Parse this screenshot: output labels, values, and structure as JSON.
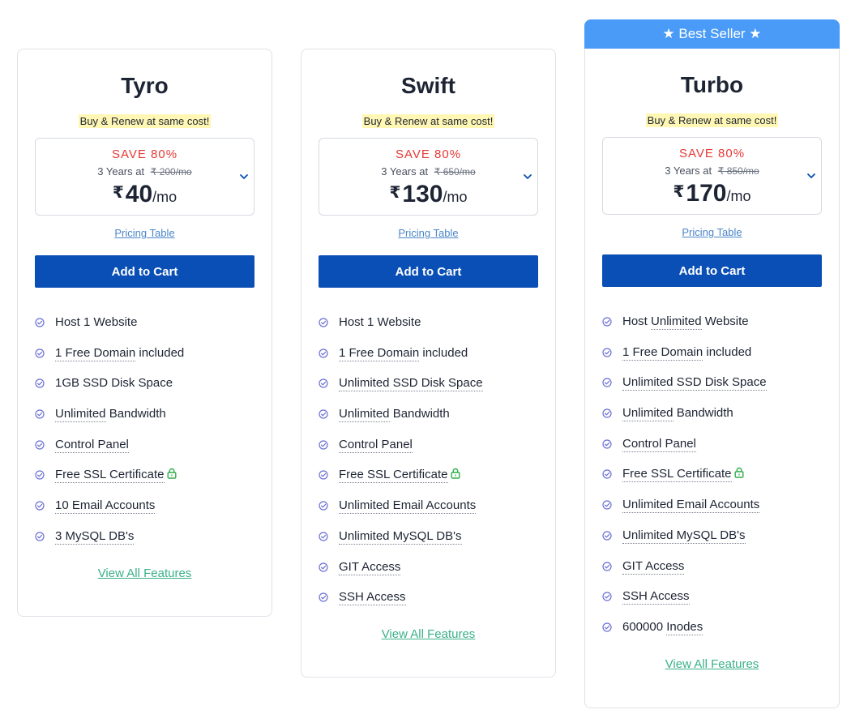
{
  "plans": [
    {
      "name": "Tyro",
      "tagline": "Buy & Renew at same cost!",
      "save": "SAVE 80%",
      "term": "3 Years at",
      "old_price": "₹ 200/mo",
      "currency": "₹",
      "price": "40",
      "per": "/mo",
      "pricing_link": "Pricing Table",
      "cta": "Add to Cart",
      "view_all": "View All Features",
      "features": [
        {
          "pre": "Host 1 Website",
          "u": "",
          "post": ""
        },
        {
          "pre": "",
          "u": "1 Free Domain",
          "post": " included"
        },
        {
          "pre": "1GB SSD Disk Space",
          "u": "",
          "post": ""
        },
        {
          "pre": "",
          "u": "Unlimited",
          "post": " Bandwidth"
        },
        {
          "pre": "",
          "u": "Control Panel",
          "post": ""
        },
        {
          "pre": "",
          "u": "Free SSL Certificate",
          "post": "",
          "lock": true
        },
        {
          "pre": "",
          "u": "10 Email Accounts",
          "post": ""
        },
        {
          "pre": "",
          "u": "3 MySQL DB's",
          "post": ""
        }
      ]
    },
    {
      "name": "Swift",
      "tagline": "Buy & Renew at same cost!",
      "save": "SAVE 80%",
      "term": "3 Years at",
      "old_price": "₹ 650/mo",
      "currency": "₹",
      "price": "130",
      "per": "/mo",
      "pricing_link": "Pricing Table",
      "cta": "Add to Cart",
      "view_all": "View All Features",
      "features": [
        {
          "pre": "Host 1 Website",
          "u": "",
          "post": ""
        },
        {
          "pre": "",
          "u": "1 Free Domain",
          "post": " included"
        },
        {
          "pre": "",
          "u": "Unlimited SSD Disk Space",
          "post": ""
        },
        {
          "pre": "",
          "u": "Unlimited",
          "post": " Bandwidth"
        },
        {
          "pre": "",
          "u": "Control Panel",
          "post": ""
        },
        {
          "pre": "",
          "u": "Free SSL Certificate",
          "post": "",
          "lock": true
        },
        {
          "pre": "",
          "u": "Unlimited Email Accounts",
          "post": ""
        },
        {
          "pre": "",
          "u": "Unlimited MySQL DB's",
          "post": ""
        },
        {
          "pre": "",
          "u": "GIT Access",
          "post": ""
        },
        {
          "pre": "",
          "u": "SSH Access",
          "post": ""
        }
      ]
    },
    {
      "name": "Turbo",
      "badge": "★ Best Seller ★",
      "tagline": "Buy & Renew at same cost!",
      "save": "SAVE 80%",
      "term": "3 Years at",
      "old_price": "₹ 850/mo",
      "currency": "₹",
      "price": "170",
      "per": "/mo",
      "pricing_link": "Pricing Table",
      "cta": "Add to Cart",
      "view_all": "View All Features",
      "features": [
        {
          "pre": "Host ",
          "u": "Unlimited",
          "post": " Website"
        },
        {
          "pre": "",
          "u": "1 Free Domain",
          "post": " included"
        },
        {
          "pre": "",
          "u": "Unlimited SSD Disk Space",
          "post": ""
        },
        {
          "pre": "",
          "u": "Unlimited",
          "post": " Bandwidth"
        },
        {
          "pre": "",
          "u": "Control Panel",
          "post": ""
        },
        {
          "pre": "",
          "u": "Free SSL Certificate",
          "post": "",
          "lock": true
        },
        {
          "pre": "",
          "u": "Unlimited Email Accounts",
          "post": ""
        },
        {
          "pre": "",
          "u": "Unlimited MySQL DB's",
          "post": ""
        },
        {
          "pre": "",
          "u": "GIT Access",
          "post": ""
        },
        {
          "pre": "",
          "u": "SSH Access",
          "post": ""
        },
        {
          "pre": "600000 ",
          "u": "Inodes",
          "post": ""
        }
      ]
    }
  ],
  "colors": {
    "accent_button": "#0a4fb5",
    "badge": "#4a9bf7",
    "save_red": "#e53935",
    "view_all_green": "#3ab08a",
    "check_icon": "#6b6fd6",
    "lock_icon": "#2fae4a",
    "tagline_highlight": "#fff7b3"
  },
  "icons": {
    "feature": "check-circle-icon",
    "expand": "chevron-down-icon",
    "ssl": "lock-icon",
    "currency": "rupee-symbol"
  }
}
